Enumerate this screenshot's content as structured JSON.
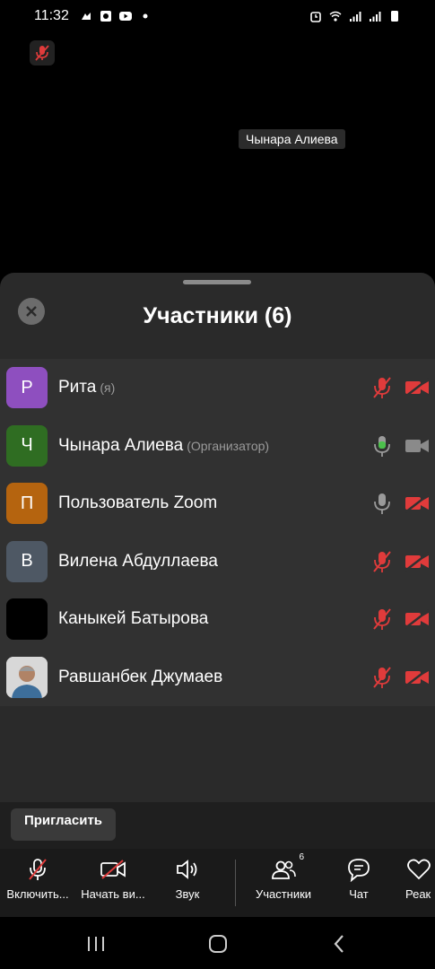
{
  "status_bar": {
    "time": "11:32"
  },
  "video": {
    "speaker_name": "Чынара Алиева"
  },
  "panel": {
    "title": "Участники (6)"
  },
  "participants": [
    {
      "name": "Рита",
      "tag": "(я)",
      "initial": "Р",
      "avatar_color": "#8e4fbf",
      "mic": "muted",
      "camera": "off"
    },
    {
      "name": "Чынара Алиева",
      "tag": "(Организатор)",
      "initial": "Ч",
      "avatar_color": "#2f6d22",
      "mic": "active",
      "camera": "on"
    },
    {
      "name": "Пользователь Zoom",
      "tag": "",
      "initial": "П",
      "avatar_color": "#b5640f",
      "mic": "idle",
      "camera": "off"
    },
    {
      "name": "Вилена Абдуллаева",
      "tag": "",
      "initial": "В",
      "avatar_color": "#4e5864",
      "mic": "muted",
      "camera": "off"
    },
    {
      "name": "Каныкей Батырова",
      "tag": "",
      "initial": "",
      "avatar_color": "#000000",
      "mic": "muted",
      "camera": "off"
    },
    {
      "name": "Равшанбек Джумаев",
      "tag": "",
      "initial": "",
      "avatar_color": "#c9c9c9",
      "mic": "muted",
      "camera": "off"
    }
  ],
  "invite": {
    "label": "Пригласить"
  },
  "toolbar": {
    "unmute": "Включить...",
    "start_video": "Начать ви...",
    "audio": "Звук",
    "participants": "Участники",
    "participants_count": "6",
    "chat": "Чат",
    "reactions": "Реак"
  },
  "colors": {
    "muted_red": "#e03b3b",
    "active_green": "#4cc14c",
    "idle_gray": "#9a9a9a"
  }
}
